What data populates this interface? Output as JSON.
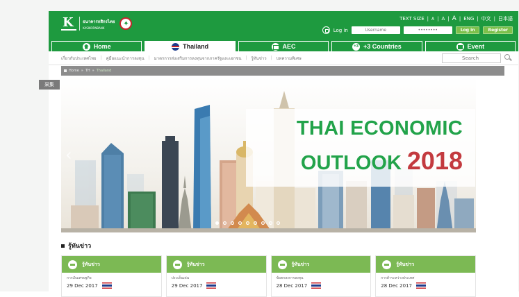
{
  "header": {
    "bank_name_th": "ธนาคารกสิกรไทย",
    "bank_name_en": "KASIKORNBANK",
    "text_size_label": "TEXT SIZE",
    "text_size_options": [
      "A",
      "A",
      "A"
    ],
    "languages": [
      "ENG",
      "中文",
      "日本語"
    ],
    "login_label": "Log in",
    "username_placeholder": "Username",
    "password_placeholder": "••••••••",
    "login_button": "Log in",
    "register_button": "Register"
  },
  "tabs": [
    {
      "label": "Home",
      "icon": "home-icon",
      "active": false
    },
    {
      "label": "Thailand",
      "icon": "thai-flag-icon",
      "active": true
    },
    {
      "label": "AEC",
      "icon": "aec-icon",
      "active": false
    },
    {
      "label": "+3 Countries",
      "icon": "plus-three-icon",
      "active": false
    },
    {
      "label": "Event",
      "icon": "event-icon",
      "active": false
    }
  ],
  "subnav": {
    "items": [
      "เกี่ยวกับประเทศไทย",
      "คู่มือแนะนำการลงทุน",
      "มาตรการส่งเสริมการลงทุนจากภาครัฐและเอกชน",
      "รู้ทันข่าว",
      "บทความพิเศษ"
    ],
    "search_placeholder": "Search"
  },
  "breadcrumb": [
    "Home",
    "TH",
    "Thailand"
  ],
  "side_tag": "采集",
  "banner": {
    "line1": "THAI ECONOMIC",
    "line2": "OUTLOOK",
    "year": "2018",
    "slide_count": 9,
    "active_slide": 0
  },
  "news": {
    "section_title": "รู้ทันข่าว",
    "cards": [
      {
        "title": "รู้ทันข่าว",
        "subtitle": "การเงินเศรษฐกิจ",
        "date": "29 Dec 2017"
      },
      {
        "title": "รู้ทันข่าว",
        "subtitle": "ประเด็นเด่น",
        "date": "29 Dec 2017"
      },
      {
        "title": "รู้ทันข่าว",
        "subtitle": "ข้อตกลงการลงทุน",
        "date": "28 Dec 2017"
      },
      {
        "title": "รู้ทันข่าว",
        "subtitle": "การค้าระหว่างประเทศ",
        "date": "28 Dec 2017"
      }
    ]
  },
  "colors": {
    "brand_green": "#1e9a3f",
    "card_green": "#7cb954",
    "headline_green": "#22a34a",
    "headline_red": "#c33a3f"
  }
}
